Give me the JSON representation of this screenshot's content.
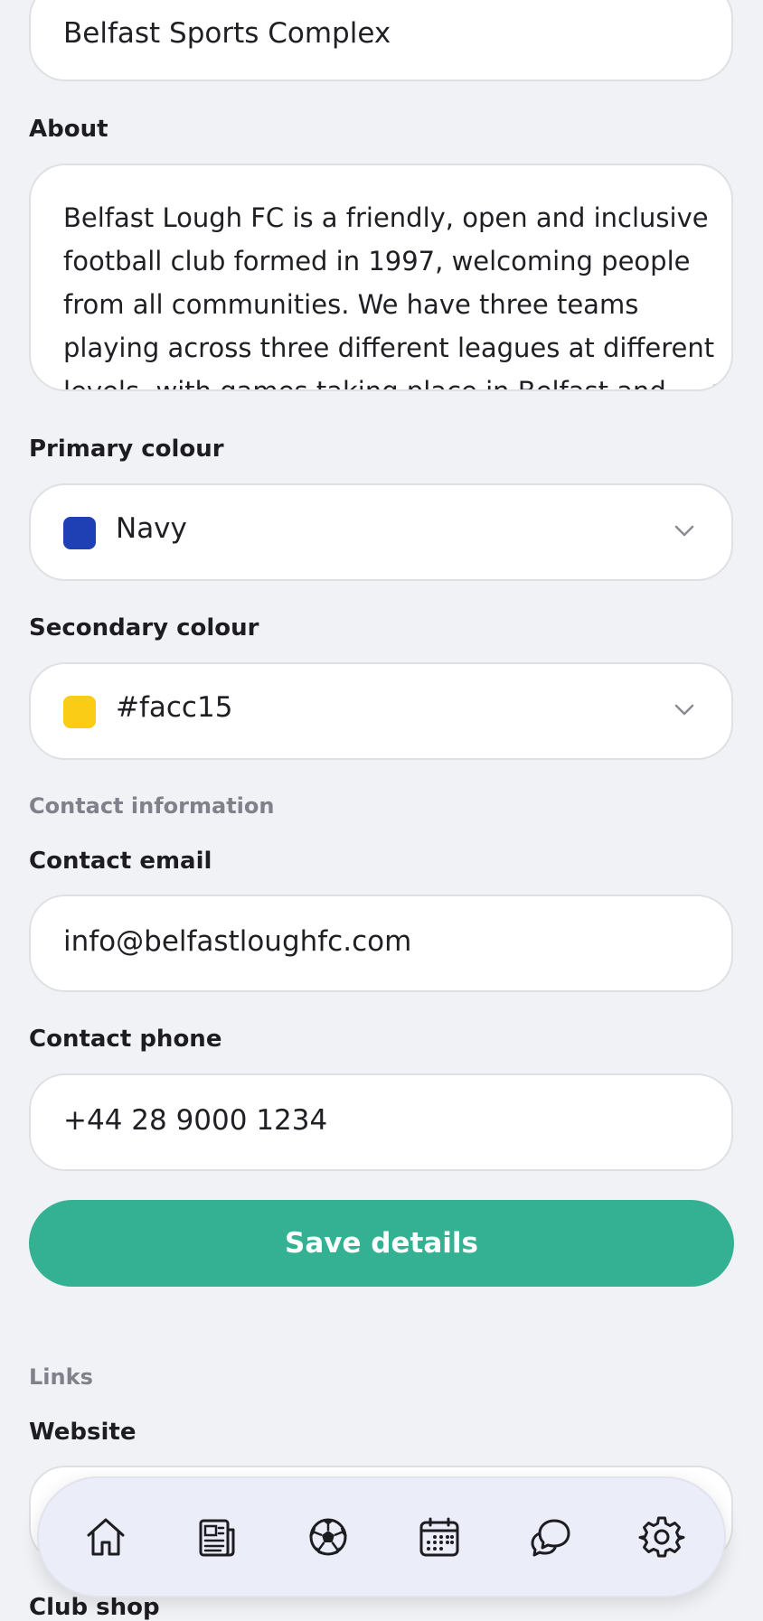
{
  "venue_field": {
    "value": "Belfast Sports Complex"
  },
  "about": {
    "label": "About",
    "text": "Belfast Lough FC is a friendly, open and inclusive football club formed in 1997, welcoming people from all communities. We have three teams playing across three different leagues at different levels, with games taking place in Belfast and the"
  },
  "primary_colour": {
    "label": "Primary colour",
    "value": "Navy",
    "swatch": "#1f3fb5"
  },
  "secondary_colour": {
    "label": "Secondary colour",
    "value": "#facc15",
    "swatch": "#facc15"
  },
  "contact": {
    "section_label": "Contact information",
    "email_label": "Contact email",
    "email_value": "info@belfastloughfc.com",
    "phone_label": "Contact phone",
    "phone_value": "+44 28 9000 1234"
  },
  "save_label": "Save details",
  "links": {
    "section_label": "Links",
    "website_label": "Website",
    "club_shop_label": "Club shop"
  },
  "nav": {
    "items": [
      {
        "icon": "home-icon"
      },
      {
        "icon": "news-icon"
      },
      {
        "icon": "football-icon"
      },
      {
        "icon": "calendar-icon"
      },
      {
        "icon": "chat-icon"
      },
      {
        "icon": "settings-icon"
      }
    ]
  },
  "colors": {
    "accent": "#34b192",
    "background": "#f1f2f5"
  }
}
